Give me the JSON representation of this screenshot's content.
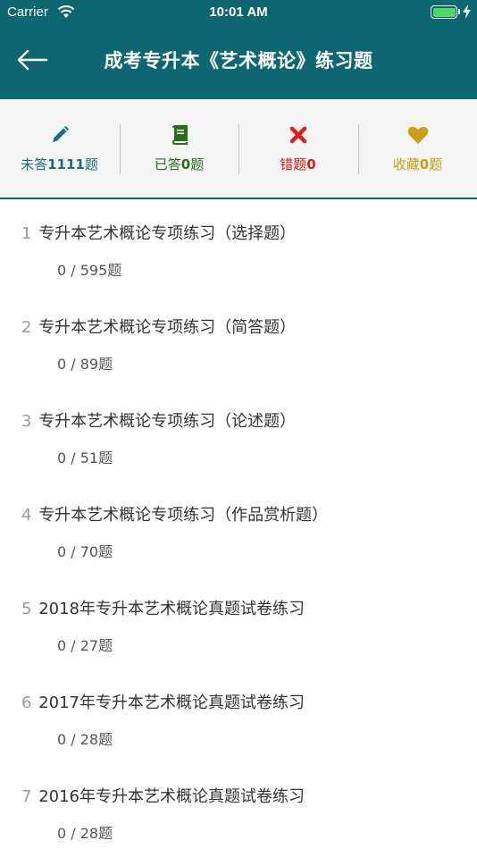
{
  "status_bar": {
    "carrier": "Carrier",
    "time": "10:01 AM"
  },
  "nav": {
    "title": "成考专升本《艺术概论》练习题"
  },
  "stats": [
    {
      "prefix": "未答",
      "count": "1111",
      "suffix": "题",
      "color": "#1b6e78",
      "icon": "pencil-icon"
    },
    {
      "prefix": "已答",
      "count": "0",
      "suffix": "题",
      "color": "#2d6b1e",
      "icon": "book-icon"
    },
    {
      "prefix": "错题",
      "count": "0",
      "suffix": "",
      "color": "#e01b1b",
      "icon": "cross-icon"
    },
    {
      "prefix": "收藏",
      "count": "0",
      "suffix": "题",
      "color": "#c8a016",
      "icon": "heart-icon"
    }
  ],
  "items": [
    {
      "num": "1",
      "title": "专升本艺术概论专项练习（选择题）",
      "progress": "0 / 595题"
    },
    {
      "num": "2",
      "title": "专升本艺术概论专项练习（简答题）",
      "progress": "0 / 89题"
    },
    {
      "num": "3",
      "title": "专升本艺术概论专项练习（论述题）",
      "progress": "0 / 51题"
    },
    {
      "num": "4",
      "title": "专升本艺术概论专项练习（作品赏析题）",
      "progress": "0 / 70题"
    },
    {
      "num": "5",
      "title": "2018年专升本艺术概论真题试卷练习",
      "progress": "0 / 27题"
    },
    {
      "num": "6",
      "title": "2017年专升本艺术概论真题试卷练习",
      "progress": "0 / 28题"
    },
    {
      "num": "7",
      "title": "2016年专升本艺术概论真题试卷练习",
      "progress": "0 / 28题"
    }
  ]
}
